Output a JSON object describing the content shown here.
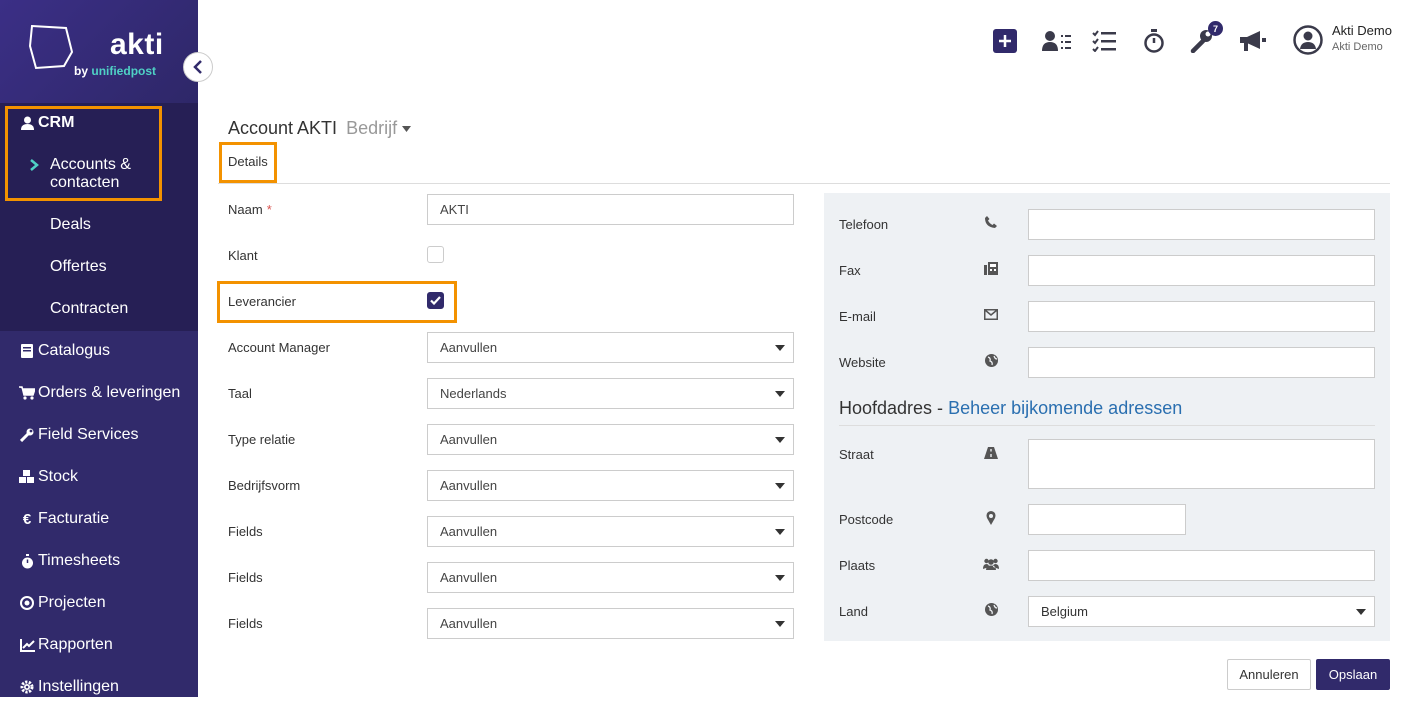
{
  "brand": {
    "name": "akti",
    "by": "by",
    "sub": "unifiedpost"
  },
  "sidebar": {
    "crm": "CRM",
    "sub_items": [
      "Accounts & contacten",
      "Deals",
      "Offertes",
      "Contracten"
    ],
    "items": [
      {
        "label": "Catalogus",
        "icon": "book-icon"
      },
      {
        "label": "Orders & leveringen",
        "icon": "cart-icon"
      },
      {
        "label": "Field Services",
        "icon": "wrench-icon"
      },
      {
        "label": "Stock",
        "icon": "cubes-icon"
      },
      {
        "label": "Facturatie",
        "icon": "euro-icon"
      },
      {
        "label": "Timesheets",
        "icon": "stopwatch-icon"
      },
      {
        "label": "Projecten",
        "icon": "target-icon"
      },
      {
        "label": "Rapporten",
        "icon": "chart-icon"
      },
      {
        "label": "Instellingen",
        "icon": "gear-icon"
      }
    ]
  },
  "topbar": {
    "badge_count": "7",
    "user_name": "Akti Demo",
    "user_company": "Akti Demo"
  },
  "page": {
    "title": "Account AKTI",
    "subtitle": "Bedrijf",
    "tab": "Details"
  },
  "form": {
    "naam_label": "Naam",
    "naam_required": "*",
    "naam_value": "AKTI",
    "klant_label": "Klant",
    "klant_checked": false,
    "leverancier_label": "Leverancier",
    "leverancier_checked": true,
    "selects": [
      {
        "label": "Account Manager",
        "value": "Aanvullen"
      },
      {
        "label": "Taal",
        "value": "Nederlands"
      },
      {
        "label": "Type relatie",
        "value": "Aanvullen"
      },
      {
        "label": "Bedrijfsvorm",
        "value": "Aanvullen"
      },
      {
        "label": "Fields",
        "value": "Aanvullen"
      },
      {
        "label": "Fields",
        "value": "Aanvullen"
      },
      {
        "label": "Fields",
        "value": "Aanvullen"
      }
    ]
  },
  "contact": {
    "telefoon": "Telefoon",
    "fax": "Fax",
    "email": "E-mail",
    "website": "Website",
    "address_title": "Hoofdadres -",
    "address_link": "Beheer bijkomende adressen",
    "straat": "Straat",
    "postcode": "Postcode",
    "plaats": "Plaats",
    "land": "Land",
    "land_value": "Belgium"
  },
  "buttons": {
    "cancel": "Annuleren",
    "save": "Opslaan"
  }
}
